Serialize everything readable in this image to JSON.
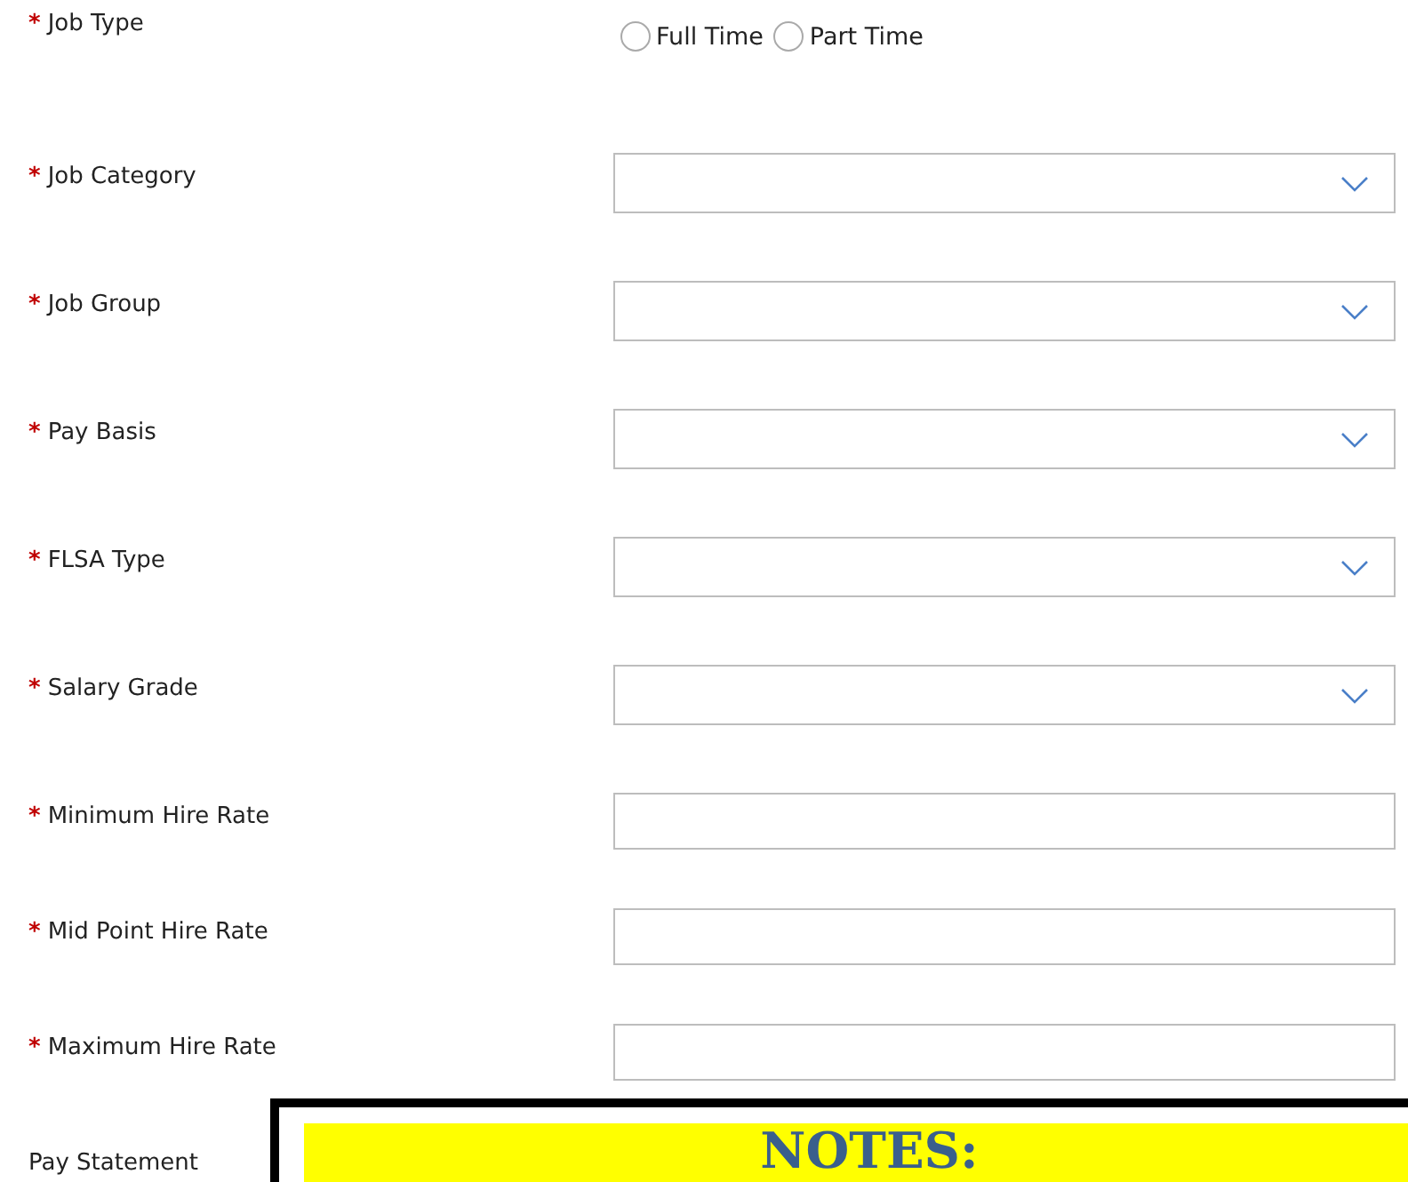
{
  "fields": [
    {
      "kind": "radio",
      "mark": "*",
      "label": "Job Type",
      "options": [
        {
          "label": "Full Time",
          "selected": false
        },
        {
          "label": "Part Time",
          "selected": false
        }
      ]
    },
    {
      "kind": "select",
      "mark": "*",
      "label": "Job Category"
    },
    {
      "kind": "select",
      "mark": "*",
      "label": "Job Group"
    },
    {
      "kind": "select",
      "mark": "*",
      "label": "Pay Basis"
    },
    {
      "kind": "select",
      "mark": "*",
      "label": "FLSA Type"
    },
    {
      "kind": "select",
      "mark": "*",
      "label": "Salary Grade"
    },
    {
      "kind": "input",
      "mark": "*",
      "label": "Minimum Hire Rate"
    },
    {
      "kind": "input",
      "mark": "*",
      "label": "Mid Point Hire Rate"
    },
    {
      "kind": "input",
      "mark": "*",
      "label": "Maximum Hire Rate"
    },
    {
      "kind": "notes",
      "label": "Pay Statement",
      "heading": "NOTES:"
    }
  ]
}
